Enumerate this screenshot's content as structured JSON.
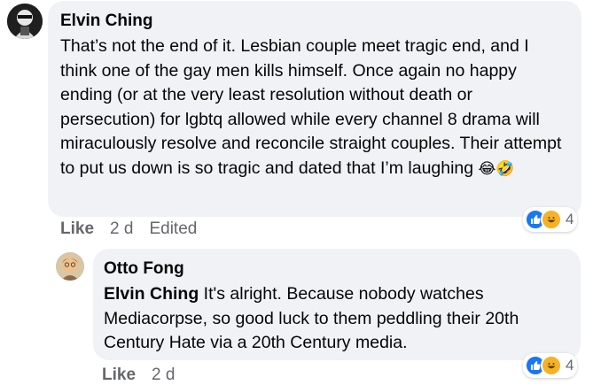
{
  "comment": {
    "author": "Elvin Ching",
    "text": "That’s not the end of it. Lesbian couple meet tragic end, and I think one of the gay men kills himself. Once again no happy ending (or at the very least resolution without death or persecution) for lgbtq allowed while every channel 8 drama will miraculously resolve and reconcile straight couples. Their attempt to put us down is so tragic and dated that I’m laughing",
    "emojis": [
      "😂",
      "🤣"
    ],
    "like_label": "Like",
    "time": "2 d",
    "edited": "Edited",
    "reaction_count": "4",
    "reaction_icons": [
      "like-icon",
      "haha-icon"
    ]
  },
  "reply": {
    "author": "Otto Fong",
    "mention": "Elvin Ching",
    "text": " It's alright. Because nobody watches Mediacorpse, so good luck to them peddling their 20th Century Hate via a 20th Century media.",
    "like_label": "Like",
    "time": "2 d",
    "reaction_count": "4",
    "reaction_icons": [
      "like-icon",
      "haha-icon"
    ]
  },
  "colors": {
    "bubble": "#f0f2f5",
    "meta_text": "#65676b",
    "like_blue": "#1877f2",
    "haha_yellow": "#f7b125"
  }
}
